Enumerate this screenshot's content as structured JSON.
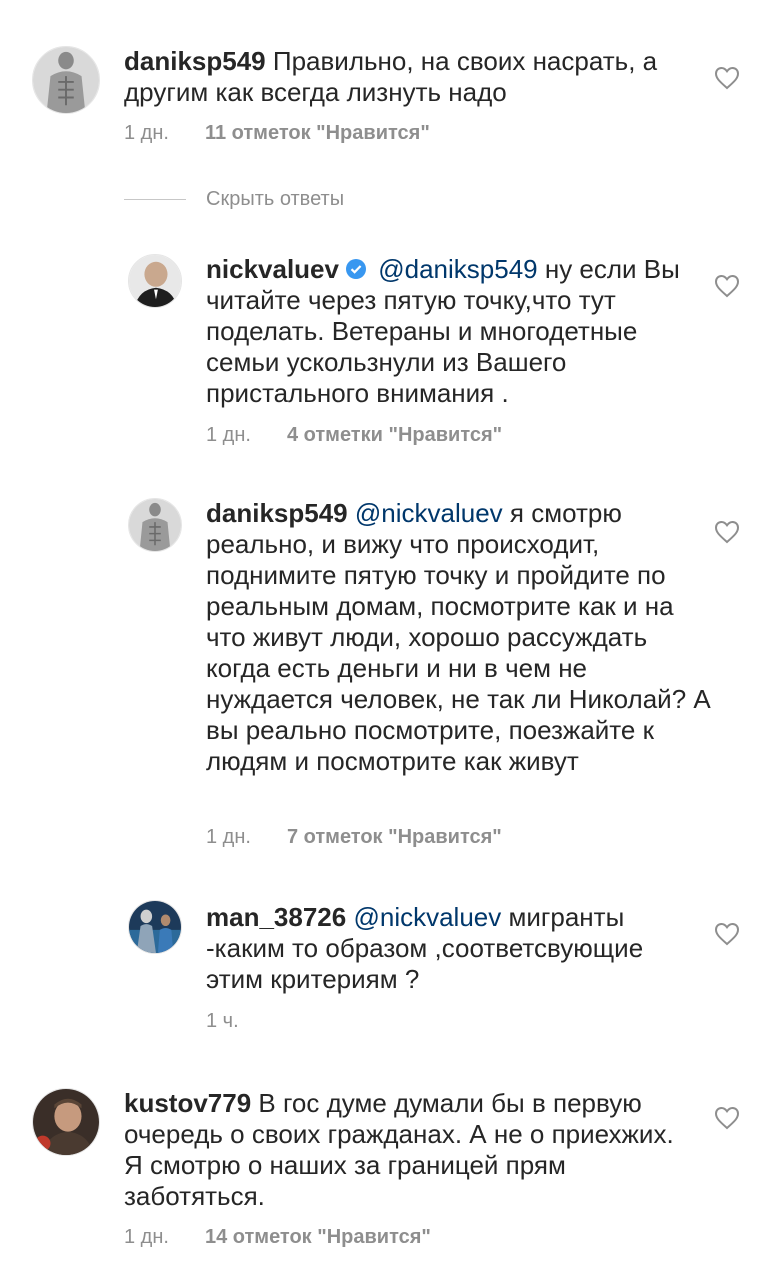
{
  "comments": [
    {
      "username": "daniksp549",
      "mention": "",
      "text": "Правильно, на своих насрать, а другим как всегда лизнуть надо",
      "time": "1 дн.",
      "likes": "11 отметок \"Нравится\""
    },
    {
      "username": "nickvaluev",
      "verified": true,
      "mention": "@daniksp549",
      "text": "ну если Вы читайте через пятую точку,что тут поделать. Ветераны и многодетные семьи ускользнули из Вашего пристального внимания .",
      "time": "1 дн.",
      "likes": "4 отметки \"Нравится\""
    },
    {
      "username": "daniksp549",
      "mention": "@nickvaluev",
      "text": "я смотрю реально, и вижу что происходит, поднимите пятую точку и пройдите по реальным домам, посмотрите как и на что живут люди, хорошо рассуждать когда есть деньги и ни в чем не нуждается человек, не так ли Николай? А вы реально посмотрите, поезжайте к людям и посмотрите как живут",
      "time": "1 дн.",
      "likes": "7 отметок \"Нравится\""
    },
    {
      "username": "man_38726",
      "mention": "@nickvaluev",
      "text": "мигранты -каким то образом ,соответсвующие этим критериям ?",
      "time": "1 ч.",
      "likes": ""
    },
    {
      "username": "kustov779",
      "mention": "",
      "text": "В гос думе думали бы в первую очередь о своих гражданах. А не о приехжих. Я смотрю о наших за границей прям заботяться.",
      "time": "1 дн.",
      "likes": "14 отметок \"Нравится\""
    }
  ],
  "hide_replies_label": "Скрыть ответы",
  "colors": {
    "text": "#262626",
    "muted": "#8e8e8e",
    "mention": "#00376b",
    "verified": "#3897f0"
  },
  "icons": [
    "heart-outline-icon",
    "verified-badge-icon"
  ]
}
